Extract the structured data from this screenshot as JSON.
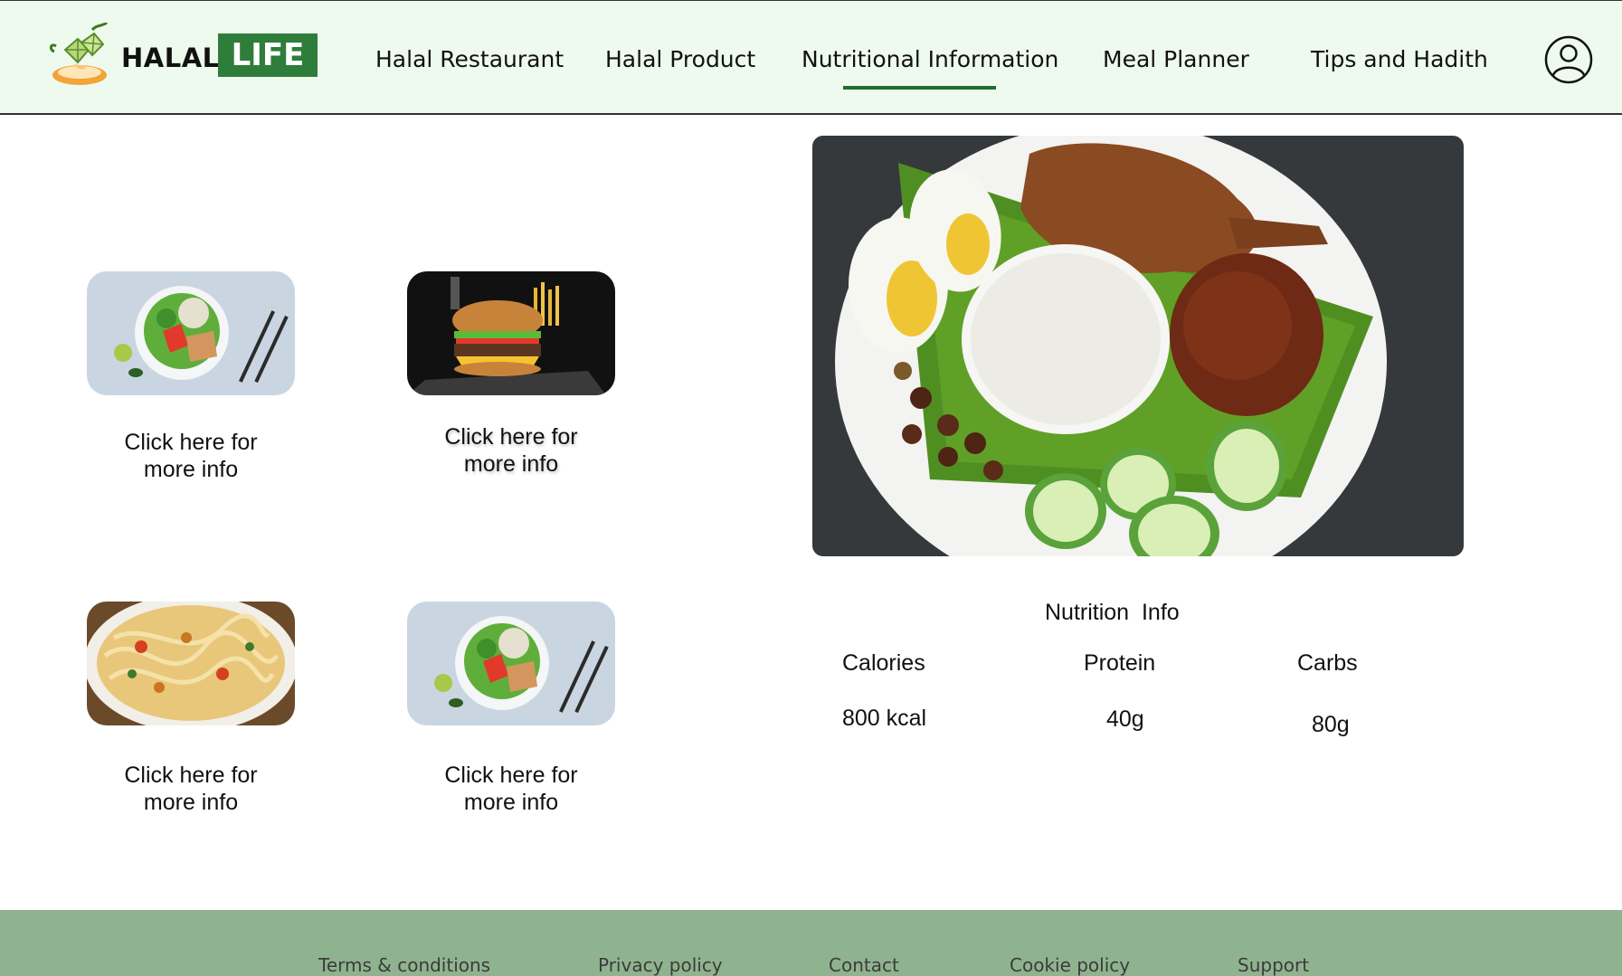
{
  "header": {
    "logo": {
      "word1": "HALAL",
      "word2": "LIFE"
    },
    "nav": [
      {
        "label": "Halal Restaurant"
      },
      {
        "label": "Halal Product"
      },
      {
        "label": "Nutritional Information",
        "active": true
      },
      {
        "label": "Meal Planner"
      },
      {
        "label": "Tips and Hadith"
      }
    ],
    "profile_icon": "user-circle-icon"
  },
  "cards": [
    {
      "image": "salad-bowl",
      "label_line1": "Click here for",
      "label_line2": "more info"
    },
    {
      "image": "burger",
      "label_line1": "Click here for",
      "label_line2": "more info"
    },
    {
      "image": "pasta",
      "label_line1": "Click here for",
      "label_line2": "more info"
    },
    {
      "image": "salad-bowl",
      "label_line1": "Click here for",
      "label_line2": "more info"
    }
  ],
  "hero": {
    "image": "nasi-lemak-plate"
  },
  "nutrition": {
    "title": "Nutrition  Info",
    "headers": [
      "Calories",
      "Protein",
      "Carbs"
    ],
    "values": [
      "800 kcal",
      "40g",
      "80g"
    ]
  },
  "footer": {
    "links": [
      "Terms & conditions",
      "Privacy policy",
      "Contact",
      "Cookie policy",
      "Support"
    ]
  },
  "colors": {
    "header_bg": "#eefaee",
    "brand_green": "#2e7d3a",
    "nav_underline": "#1f6d31",
    "footer_bg": "#8fb38f"
  }
}
